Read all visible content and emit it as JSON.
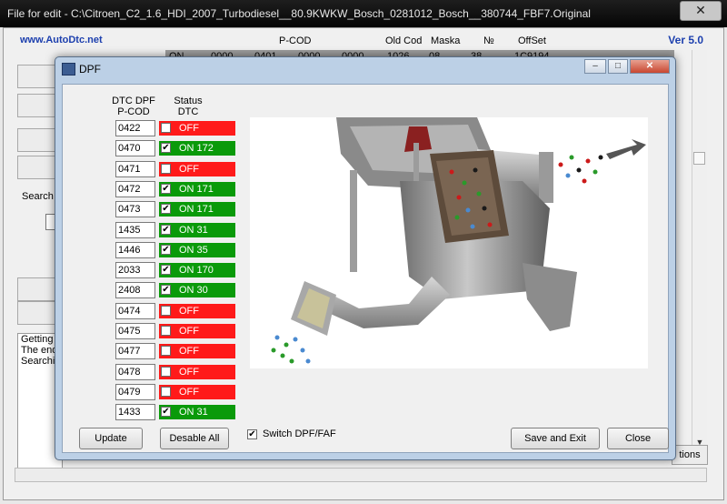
{
  "main": {
    "title": "File for edit - C:\\Citroen_C2_1.6_HDI_2007_Turbodiesel__80.9KWKW_Bosch_0281012_Bosch__380744_FBF7.Original",
    "close_glyph": "✕",
    "site": "www.AutoDtc.net",
    "version": "Ver 5.0",
    "headers": {
      "pcod": "P-COD",
      "old_cod": "Old Cod",
      "maska": "Maska",
      "num": "№",
      "offset": "OffSet"
    },
    "first_row": [
      "ON",
      "0000",
      "0401",
      "0000",
      "0000",
      "1026",
      "08",
      "38",
      "1C9194"
    ],
    "search_label": "Search",
    "log_lines": [
      "Getting re",
      "The end c",
      "Searching"
    ],
    "options_button": "tions"
  },
  "dialog": {
    "title": "DPF",
    "controls": {
      "minimize": "–",
      "maximize": "□",
      "close": "✕"
    },
    "col_dtc": "DTC DPF\nP-COD",
    "col_dtc_line1": "DTC DPF",
    "col_dtc_line2": "P-COD",
    "col_status_line1": "Status",
    "col_status_line2": "DTC",
    "rows": [
      {
        "code": "0422",
        "checked": false,
        "status": "OFF"
      },
      {
        "code": "0470",
        "checked": true,
        "status": "ON 172"
      },
      {
        "code": "0471",
        "checked": false,
        "status": "OFF"
      },
      {
        "code": "0472",
        "checked": true,
        "status": "ON 171"
      },
      {
        "code": "0473",
        "checked": true,
        "status": "ON 171"
      },
      {
        "code": "1435",
        "checked": true,
        "status": "ON 31"
      },
      {
        "code": "1446",
        "checked": true,
        "status": "ON 35"
      },
      {
        "code": "2033",
        "checked": true,
        "status": "ON 170"
      },
      {
        "code": "2408",
        "checked": true,
        "status": "ON 30"
      },
      {
        "code": "0474",
        "checked": false,
        "status": "OFF"
      },
      {
        "code": "0475",
        "checked": false,
        "status": "OFF"
      },
      {
        "code": "0477",
        "checked": false,
        "status": "OFF"
      },
      {
        "code": "0478",
        "checked": false,
        "status": "OFF"
      },
      {
        "code": "0479",
        "checked": false,
        "status": "OFF"
      },
      {
        "code": "1433",
        "checked": true,
        "status": "ON 31"
      }
    ],
    "buttons": {
      "update": "Update",
      "disable_all": "Desable All",
      "save_exit": "Save and Exit",
      "close": "Close"
    },
    "switch_label": "Switch DPF/FAF",
    "switch_checked": true,
    "colors": {
      "on": "#0a9a0a",
      "off": "#ff1a1a"
    }
  }
}
